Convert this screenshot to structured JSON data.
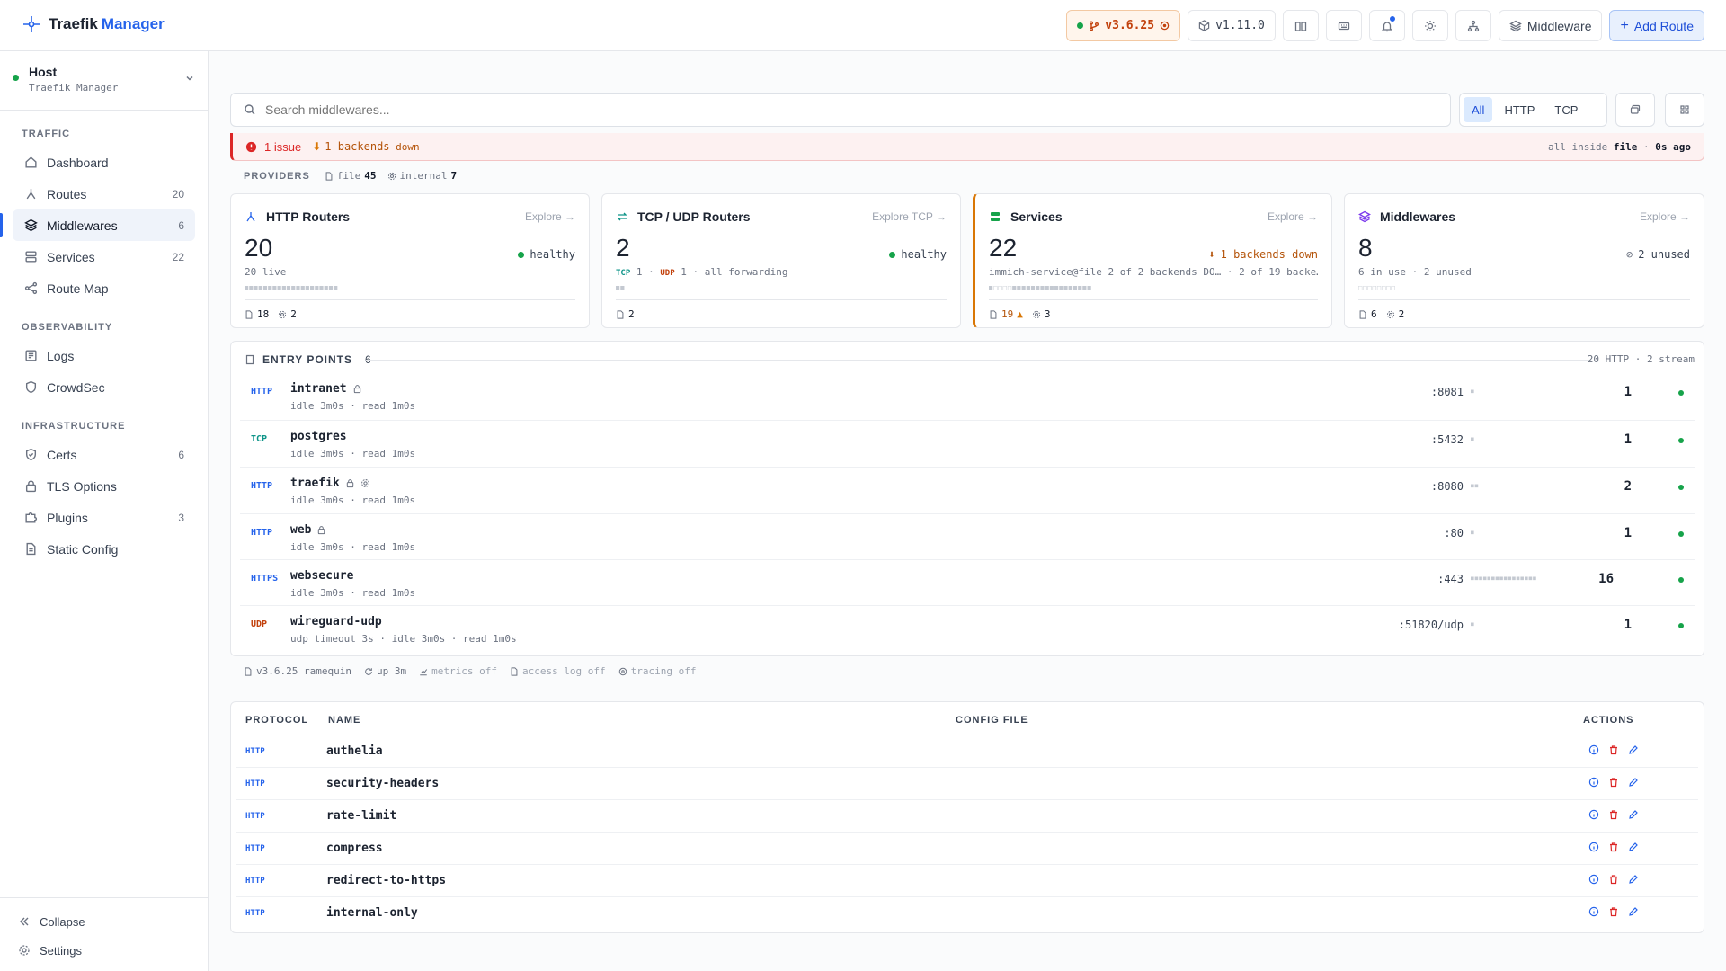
{
  "brand": {
    "name1": "Traefik",
    "name2": "Manager"
  },
  "header": {
    "version": "v3.6.25",
    "manager_version": "v1.11.0",
    "middleware_label": "Middleware",
    "add_route_label": "Add Route"
  },
  "sidebar": {
    "host_name": "Host",
    "host_sub": "Traefik Manager",
    "sections": [
      {
        "title": "TRAFFIC"
      },
      {
        "title": "OBSERVABILITY"
      },
      {
        "title": "INFRASTRUCTURE"
      }
    ],
    "items": [
      {
        "label": "Dashboard",
        "count": ""
      },
      {
        "label": "Routes",
        "count": "20"
      },
      {
        "label": "Middlewares",
        "count": "6"
      },
      {
        "label": "Services",
        "count": "22"
      },
      {
        "label": "Route Map",
        "count": ""
      },
      {
        "label": "Logs",
        "count": ""
      },
      {
        "label": "CrowdSec",
        "count": ""
      },
      {
        "label": "Certs",
        "count": "6"
      },
      {
        "label": "TLS Options",
        "count": ""
      },
      {
        "label": "Plugins",
        "count": "3"
      },
      {
        "label": "Static Config",
        "count": ""
      }
    ],
    "collapse_label": "Collapse",
    "settings_label": "Settings"
  },
  "search": {
    "placeholder": "Search middlewares..."
  },
  "filters": {
    "all": "All",
    "http": "HTTP",
    "tcp": "TCP"
  },
  "alert": {
    "issue": "1 issue",
    "backends": "1 backends",
    "down": "down",
    "right_prefix": "all inside",
    "right_file": "file",
    "right_time": "0s ago"
  },
  "providers": {
    "label": "PROVIDERS",
    "file_label": "file",
    "file_count": "45",
    "internal_label": "internal",
    "internal_count": "7"
  },
  "cards": {
    "http": {
      "title": "HTTP Routers",
      "explore": "Explore →",
      "value": "20",
      "status": "healthy",
      "sub": "20 live",
      "bars": "■■■■■■■■■■■■■■■■■■■■",
      "files": "18",
      "internal": "2"
    },
    "tcp": {
      "title": "TCP / UDP Routers",
      "explore": "Explore TCP →",
      "value": "2",
      "status": "healthy",
      "sub_tcp": "TCP",
      "sub_tcp_n": "1",
      "sub_udp": "UDP",
      "sub_udp_n": "1",
      "sub_rest": "· all forwarding",
      "bars": "■■",
      "files": "2"
    },
    "services": {
      "title": "Services",
      "explore": "Explore →",
      "value": "22",
      "status": "1 backends  down",
      "sub": "immich-service@file 2 of 2 backends DO… · 2 of 19 backe…",
      "bars": "■□□□□■■■■■■■■■■■■■■■■■",
      "files": "19",
      "internal": "3"
    },
    "mw": {
      "title": "Middlewares",
      "explore": "Explore →",
      "value": "8",
      "status": "2 unused",
      "sub": "6 in use · 2 unused",
      "bars": "□□□□□□□□",
      "files": "6",
      "internal": "2"
    }
  },
  "entry_points": {
    "title": "ENTRY POINTS",
    "count": "6",
    "total": "20 HTTP · 2 stream",
    "rows": [
      {
        "proto": "HTTP",
        "name": "intranet",
        "meta": "idle 3m0s · read 1m0s",
        "port": ":8081",
        "spark": "■",
        "n": "1"
      },
      {
        "proto": "TCP",
        "name": "postgres",
        "meta": "idle 3m0s · read 1m0s",
        "port": ":5432",
        "spark": "■",
        "n": "1"
      },
      {
        "proto": "HTTP",
        "name": "traefik",
        "meta": "idle 3m0s · read 1m0s",
        "port": ":8080",
        "spark": "■■",
        "n": "2"
      },
      {
        "proto": "HTTP",
        "name": "web",
        "meta": "idle 3m0s · read 1m0s",
        "port": ":80",
        "spark": "■",
        "n": "1"
      },
      {
        "proto": "HTTPS",
        "name": "websecure",
        "meta": "idle 3m0s · read 1m0s",
        "port": ":443",
        "spark": "■■■■■■■■■■■■■■■■",
        "n": "16"
      },
      {
        "proto": "UDP",
        "name": "wireguard-udp",
        "meta": "udp timeout 3s · idle 3m0s · read 1m0s",
        "port": ":51820/udp",
        "spark": "■",
        "n": "1"
      }
    ]
  },
  "footer_stats": {
    "version": "v3.6.25 ramequin",
    "uptime": "up 3m",
    "metrics": "metrics off",
    "access": "access log off",
    "tracing": "tracing off"
  },
  "table": {
    "headers": {
      "protocol": "PROTOCOL",
      "name": "NAME",
      "config": "CONFIG FILE",
      "actions": "ACTIONS"
    },
    "rows": [
      {
        "proto": "HTTP",
        "name": "authelia"
      },
      {
        "proto": "HTTP",
        "name": "security-headers"
      },
      {
        "proto": "HTTP",
        "name": "rate-limit"
      },
      {
        "proto": "HTTP",
        "name": "compress"
      },
      {
        "proto": "HTTP",
        "name": "redirect-to-https"
      },
      {
        "proto": "HTTP",
        "name": "internal-only"
      }
    ]
  },
  "colors": {
    "accent": "#2563eb",
    "danger": "#dc2626",
    "warning": "#d97706",
    "ok": "#16a34a",
    "tcp": "#0d9488",
    "udp": "#c2410c"
  }
}
